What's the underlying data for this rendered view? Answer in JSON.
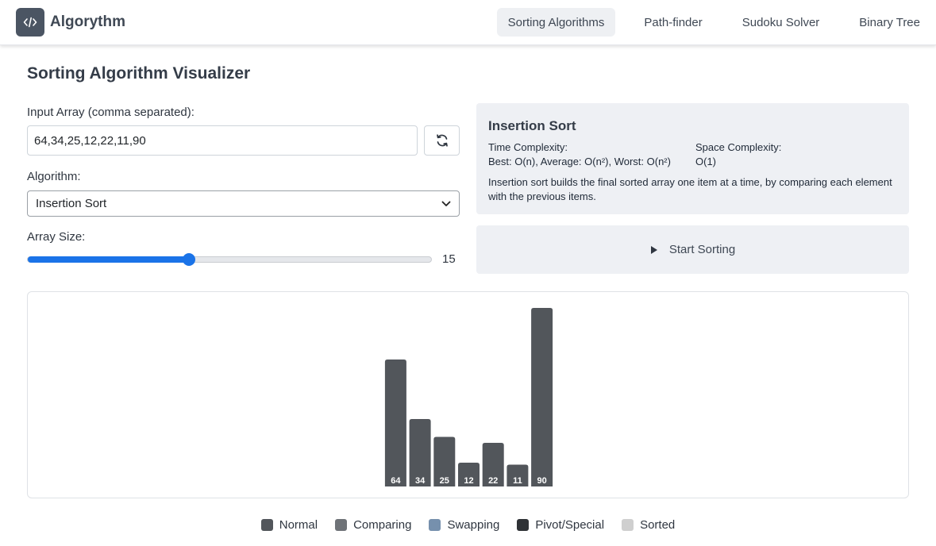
{
  "navbar": {
    "brand": "Algorythm",
    "links": [
      {
        "label": "Sorting Algorithms",
        "active": true
      },
      {
        "label": "Path-finder",
        "active": false
      },
      {
        "label": "Sudoku Solver",
        "active": false
      },
      {
        "label": "Binary Tree",
        "active": false
      }
    ]
  },
  "page": {
    "title": "Sorting Algorithm Visualizer"
  },
  "controls": {
    "input_label": "Input Array (comma separated):",
    "input_value": "64,34,25,12,22,11,90",
    "algorithm_label": "Algorithm:",
    "algorithm_selected": "Insertion Sort",
    "size_label": "Array Size:",
    "size_value": "15",
    "size_fraction": 0.4
  },
  "info": {
    "title": "Insertion Sort",
    "time_label": "Time Complexity:",
    "time_value": "Best: O(n), Average: O(n²), Worst: O(n²)",
    "space_label": "Space Complexity:",
    "space_value": "O(1)",
    "description": "Insertion sort builds the final sorted array one item at a time, by comparing each element with the previous items."
  },
  "start_button": {
    "label": "Start Sorting"
  },
  "chart_data": {
    "type": "bar",
    "categories": [
      "64",
      "34",
      "25",
      "12",
      "22",
      "11",
      "90"
    ],
    "values": [
      64,
      34,
      25,
      12,
      22,
      11,
      90
    ],
    "ylim": [
      0,
      90
    ]
  },
  "legend": [
    {
      "label": "Normal",
      "color": "#52565b"
    },
    {
      "label": "Comparing",
      "color": "#6f7378"
    },
    {
      "label": "Swapping",
      "color": "#7690ad"
    },
    {
      "label": "Pivot/Special",
      "color": "#2f3236"
    },
    {
      "label": "Sorted",
      "color": "#cfcfcf"
    }
  ],
  "colors": {
    "bar": "#52565b",
    "accent": "#1a73e8"
  }
}
